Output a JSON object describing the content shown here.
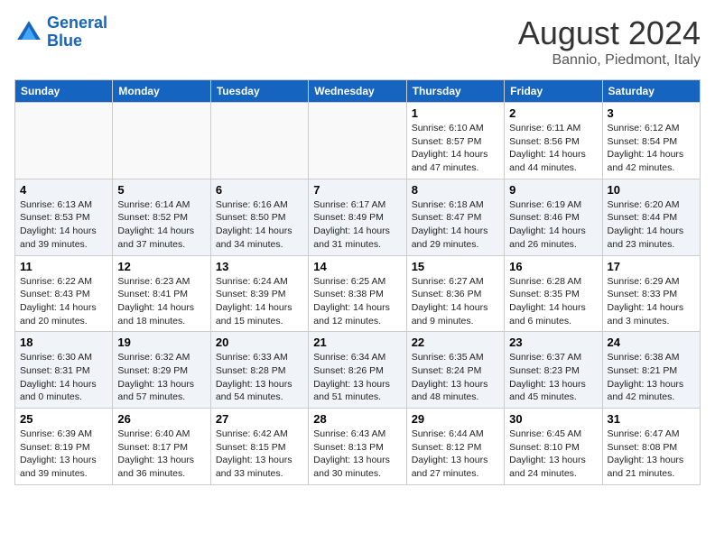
{
  "header": {
    "logo_line1": "General",
    "logo_line2": "Blue",
    "title": "August 2024",
    "subtitle": "Bannio, Piedmont, Italy"
  },
  "days_of_week": [
    "Sunday",
    "Monday",
    "Tuesday",
    "Wednesday",
    "Thursday",
    "Friday",
    "Saturday"
  ],
  "weeks": [
    {
      "row_class": "row-odd",
      "days": [
        {
          "number": "",
          "info": "",
          "empty": true
        },
        {
          "number": "",
          "info": "",
          "empty": true
        },
        {
          "number": "",
          "info": "",
          "empty": true
        },
        {
          "number": "",
          "info": "",
          "empty": true
        },
        {
          "number": "1",
          "info": "Sunrise: 6:10 AM\nSunset: 8:57 PM\nDaylight: 14 hours and 47 minutes."
        },
        {
          "number": "2",
          "info": "Sunrise: 6:11 AM\nSunset: 8:56 PM\nDaylight: 14 hours and 44 minutes."
        },
        {
          "number": "3",
          "info": "Sunrise: 6:12 AM\nSunset: 8:54 PM\nDaylight: 14 hours and 42 minutes."
        }
      ]
    },
    {
      "row_class": "row-even",
      "days": [
        {
          "number": "4",
          "info": "Sunrise: 6:13 AM\nSunset: 8:53 PM\nDaylight: 14 hours and 39 minutes."
        },
        {
          "number": "5",
          "info": "Sunrise: 6:14 AM\nSunset: 8:52 PM\nDaylight: 14 hours and 37 minutes."
        },
        {
          "number": "6",
          "info": "Sunrise: 6:16 AM\nSunset: 8:50 PM\nDaylight: 14 hours and 34 minutes."
        },
        {
          "number": "7",
          "info": "Sunrise: 6:17 AM\nSunset: 8:49 PM\nDaylight: 14 hours and 31 minutes."
        },
        {
          "number": "8",
          "info": "Sunrise: 6:18 AM\nSunset: 8:47 PM\nDaylight: 14 hours and 29 minutes."
        },
        {
          "number": "9",
          "info": "Sunrise: 6:19 AM\nSunset: 8:46 PM\nDaylight: 14 hours and 26 minutes."
        },
        {
          "number": "10",
          "info": "Sunrise: 6:20 AM\nSunset: 8:44 PM\nDaylight: 14 hours and 23 minutes."
        }
      ]
    },
    {
      "row_class": "row-odd",
      "days": [
        {
          "number": "11",
          "info": "Sunrise: 6:22 AM\nSunset: 8:43 PM\nDaylight: 14 hours and 20 minutes."
        },
        {
          "number": "12",
          "info": "Sunrise: 6:23 AM\nSunset: 8:41 PM\nDaylight: 14 hours and 18 minutes."
        },
        {
          "number": "13",
          "info": "Sunrise: 6:24 AM\nSunset: 8:39 PM\nDaylight: 14 hours and 15 minutes."
        },
        {
          "number": "14",
          "info": "Sunrise: 6:25 AM\nSunset: 8:38 PM\nDaylight: 14 hours and 12 minutes."
        },
        {
          "number": "15",
          "info": "Sunrise: 6:27 AM\nSunset: 8:36 PM\nDaylight: 14 hours and 9 minutes."
        },
        {
          "number": "16",
          "info": "Sunrise: 6:28 AM\nSunset: 8:35 PM\nDaylight: 14 hours and 6 minutes."
        },
        {
          "number": "17",
          "info": "Sunrise: 6:29 AM\nSunset: 8:33 PM\nDaylight: 14 hours and 3 minutes."
        }
      ]
    },
    {
      "row_class": "row-even",
      "days": [
        {
          "number": "18",
          "info": "Sunrise: 6:30 AM\nSunset: 8:31 PM\nDaylight: 14 hours and 0 minutes."
        },
        {
          "number": "19",
          "info": "Sunrise: 6:32 AM\nSunset: 8:29 PM\nDaylight: 13 hours and 57 minutes."
        },
        {
          "number": "20",
          "info": "Sunrise: 6:33 AM\nSunset: 8:28 PM\nDaylight: 13 hours and 54 minutes."
        },
        {
          "number": "21",
          "info": "Sunrise: 6:34 AM\nSunset: 8:26 PM\nDaylight: 13 hours and 51 minutes."
        },
        {
          "number": "22",
          "info": "Sunrise: 6:35 AM\nSunset: 8:24 PM\nDaylight: 13 hours and 48 minutes."
        },
        {
          "number": "23",
          "info": "Sunrise: 6:37 AM\nSunset: 8:23 PM\nDaylight: 13 hours and 45 minutes."
        },
        {
          "number": "24",
          "info": "Sunrise: 6:38 AM\nSunset: 8:21 PM\nDaylight: 13 hours and 42 minutes."
        }
      ]
    },
    {
      "row_class": "row-odd",
      "days": [
        {
          "number": "25",
          "info": "Sunrise: 6:39 AM\nSunset: 8:19 PM\nDaylight: 13 hours and 39 minutes."
        },
        {
          "number": "26",
          "info": "Sunrise: 6:40 AM\nSunset: 8:17 PM\nDaylight: 13 hours and 36 minutes."
        },
        {
          "number": "27",
          "info": "Sunrise: 6:42 AM\nSunset: 8:15 PM\nDaylight: 13 hours and 33 minutes."
        },
        {
          "number": "28",
          "info": "Sunrise: 6:43 AM\nSunset: 8:13 PM\nDaylight: 13 hours and 30 minutes."
        },
        {
          "number": "29",
          "info": "Sunrise: 6:44 AM\nSunset: 8:12 PM\nDaylight: 13 hours and 27 minutes."
        },
        {
          "number": "30",
          "info": "Sunrise: 6:45 AM\nSunset: 8:10 PM\nDaylight: 13 hours and 24 minutes."
        },
        {
          "number": "31",
          "info": "Sunrise: 6:47 AM\nSunset: 8:08 PM\nDaylight: 13 hours and 21 minutes."
        }
      ]
    }
  ]
}
